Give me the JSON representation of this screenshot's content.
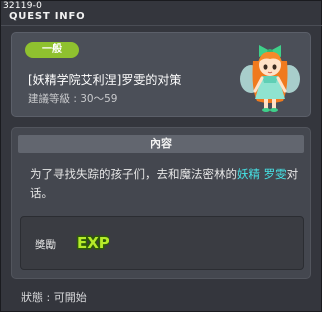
{
  "window": {
    "quest_id": "32119-0",
    "title": "QUEST INFO"
  },
  "quest": {
    "category_badge": "一般",
    "name": "[妖精学院艾利涅]罗雯的对策",
    "level_label": "建議等級 :",
    "level_range": "30～59"
  },
  "content": {
    "header": "內容",
    "description_prefix": "为了寻找失踪的孩子们，去和魔法密林的",
    "highlight_1": "妖精",
    "highlight_2": "罗雯",
    "description_suffix": "对话。"
  },
  "reward": {
    "label": "獎勵",
    "exp_text": "EXP"
  },
  "status": {
    "label": "狀態 :",
    "value": "可開始"
  },
  "colors": {
    "badge": "#8fc12f",
    "highlight": "#46e3e6",
    "exp_green": "#b6ec2a"
  },
  "icons": {
    "npc": "fairy-girl-npc-icon",
    "exp": "exp-reward-icon"
  }
}
